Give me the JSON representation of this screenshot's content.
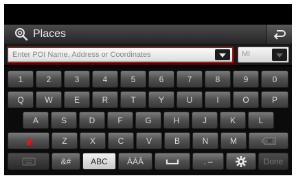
{
  "header": {
    "title": "Places"
  },
  "search": {
    "placeholder": "Enter POI Name, Address or Coordinates",
    "unit_value": "MI"
  },
  "keyboard": {
    "row1": [
      "1",
      "2",
      "3",
      "4",
      "5",
      "6",
      "7",
      "8",
      "9",
      "0"
    ],
    "row2": [
      "Q",
      "W",
      "E",
      "R",
      "T",
      "Y",
      "U",
      "I",
      "O",
      "P"
    ],
    "row3": [
      "A",
      "S",
      "D",
      "F",
      "G",
      "H",
      "J",
      "K",
      "L"
    ],
    "row4": [
      "Z",
      "X",
      "C",
      "V",
      "B",
      "N",
      "M"
    ],
    "bottom": {
      "symbols": "&#",
      "abc": "ABC",
      "accents": "ÀÁÂ",
      "dot_dash": ". –",
      "done": "Done"
    }
  },
  "icons": [
    "search-icon",
    "back-icon",
    "dropdown-icon",
    "shift-icon",
    "backspace-icon",
    "keyboard-icon",
    "space-icon",
    "settings-icon"
  ],
  "colors": {
    "accent": "#a41818",
    "shift": "#d21e1e"
  }
}
